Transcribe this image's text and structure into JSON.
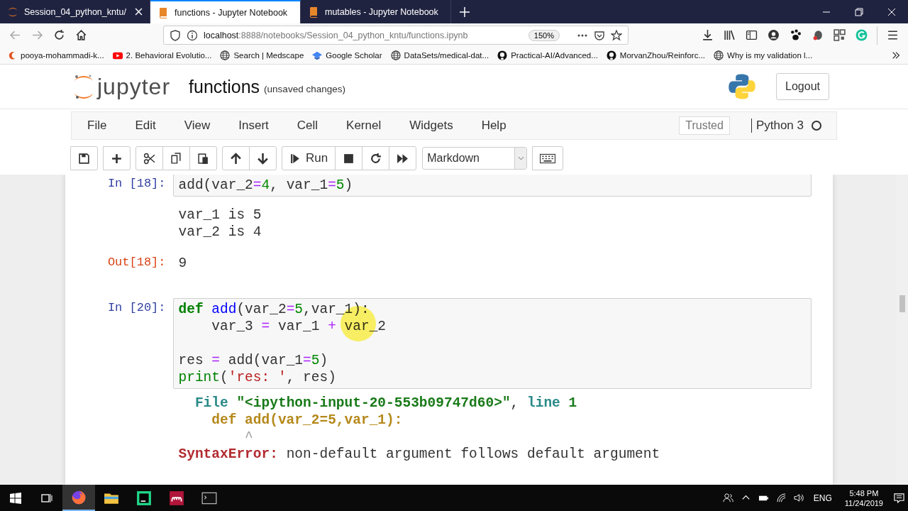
{
  "browser": {
    "tabs": [
      {
        "title": "Session_04_python_kntu/",
        "selected": false
      },
      {
        "title": "functions - Jupyter Notebook",
        "selected": true
      },
      {
        "title": "mutables - Jupyter Notebook",
        "selected": false
      }
    ],
    "url": {
      "host": "localhost",
      "path": ":8888/notebooks/Session_04_python_kntu/functions.ipynb",
      "zoom": "150%"
    },
    "bookmarks": [
      "pooya-mohammadi-k...",
      "2. Behavioral Evolutio...",
      "Search | Medscape",
      "Google Scholar",
      "DataSets/medical-dat...",
      "Practical-AI/Advanced...",
      "MorvanZhou/Reinforc...",
      "Why is my validation l..."
    ]
  },
  "notebook": {
    "logo_text": "jupyter",
    "name": "functions",
    "status": "(unsaved changes)",
    "logout": "Logout",
    "menu": [
      "File",
      "Edit",
      "View",
      "Insert",
      "Cell",
      "Kernel",
      "Widgets",
      "Help"
    ],
    "trusted": "Trusted",
    "kernel": "Python 3",
    "kernel_busy": false,
    "run_label": "Run",
    "cell_type": "Markdown",
    "cells": [
      {
        "prompt": "In [18]:",
        "lines": [
          {
            "kind": "code",
            "tokens": [
              {
                "t": "add(var_2",
                "kind": "text"
              },
              {
                "t": "=",
                "kind": "op"
              },
              {
                "t": "4",
                "kind": "num"
              },
              {
                "t": ", var_1",
                "kind": "text"
              },
              {
                "t": "=",
                "kind": "op"
              },
              {
                "t": "5",
                "kind": "num"
              },
              {
                "t": ")",
                "kind": "text"
              }
            ]
          }
        ],
        "outputs": [
          {
            "kind": "stream",
            "lines": [
              {
                "tokens": [
                  {
                    "t": "var_1 is 5",
                    "kind": "text"
                  }
                ]
              },
              {
                "tokens": [
                  {
                    "t": "var_2 is 4",
                    "kind": "text"
                  }
                ]
              }
            ]
          },
          {
            "kind": "result",
            "prompt": "Out[18]:",
            "lines": [
              {
                "tokens": [
                  {
                    "t": "9",
                    "kind": "text"
                  }
                ]
              }
            ]
          }
        ]
      },
      {
        "prompt": "In [20]:",
        "lines": [
          {
            "kind": "code",
            "tokens": [
              {
                "t": "def",
                "kind": "kw"
              },
              {
                "t": " add",
                "kind": "def"
              },
              {
                "t": "(var_2",
                "kind": "text"
              },
              {
                "t": "=",
                "kind": "op"
              },
              {
                "t": "5",
                "kind": "num"
              },
              {
                "t": ",var_1):",
                "kind": "text"
              }
            ]
          },
          {
            "kind": "code",
            "tokens": [
              {
                "t": "    var_3 ",
                "kind": "text"
              },
              {
                "t": "=",
                "kind": "op"
              },
              {
                "t": " var_1 ",
                "kind": "text"
              },
              {
                "t": "+",
                "kind": "op"
              },
              {
                "t": " var_2",
                "kind": "text"
              }
            ]
          },
          {
            "kind": "blank"
          },
          {
            "kind": "code",
            "tokens": [
              {
                "t": "res ",
                "kind": "text"
              },
              {
                "t": "=",
                "kind": "op"
              },
              {
                "t": " add(var_1",
                "kind": "text"
              },
              {
                "t": "=",
                "kind": "op"
              },
              {
                "t": "5",
                "kind": "num"
              },
              {
                "t": ")",
                "kind": "text"
              }
            ]
          },
          {
            "kind": "code",
            "tokens": [
              {
                "t": "print",
                "kind": "builtin"
              },
              {
                "t": "(",
                "kind": "text"
              },
              {
                "t": "'res: '",
                "kind": "str"
              },
              {
                "t": ", res)",
                "kind": "text"
              }
            ]
          }
        ],
        "outputs": [
          {
            "kind": "error",
            "lines": [
              {
                "tokens": [
                  {
                    "t": "  File ",
                    "kind": "tbkw"
                  },
                  {
                    "t": "\"<ipython-input-20-553b09747d60>\"",
                    "kind": "tbstr"
                  },
                  {
                    "t": ", ",
                    "kind": "text"
                  },
                  {
                    "t": "line ",
                    "kind": "tbkw"
                  },
                  {
                    "t": "1",
                    "kind": "tbstr"
                  }
                ]
              },
              {
                "tokens": [
                  {
                    "t": "    def add(var_2=5,var_1):",
                    "kind": "tbcode"
                  }
                ]
              },
              {
                "tokens": [
                  {
                    "t": "        ^",
                    "kind": "caret"
                  }
                ]
              },
              {
                "tokens": [
                  {
                    "t": "SyntaxError:",
                    "kind": "err"
                  },
                  {
                    "t": " non-default argument follows default argument",
                    "kind": "text"
                  }
                ]
              }
            ]
          }
        ]
      }
    ]
  },
  "taskbar": {
    "apps": [
      {
        "selected": true
      },
      {
        "selected": false
      },
      {
        "selected": false
      },
      {
        "selected": false
      },
      {
        "selected": false
      }
    ],
    "lang": "ENG",
    "time": "5:48 PM",
    "date": "11/24/2019"
  }
}
